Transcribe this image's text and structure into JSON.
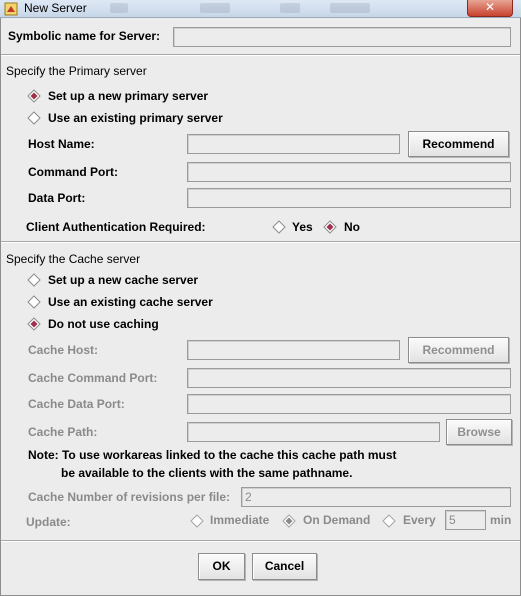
{
  "window": {
    "title": "New Server",
    "close_glyph": "✕"
  },
  "symbolic": {
    "label": "Symbolic name for Server:",
    "value": ""
  },
  "primary": {
    "section_title": "Specify the Primary server",
    "options": [
      "Set up a new primary server",
      "Use an existing primary server"
    ],
    "selected": 0,
    "host_label": "Host Name:",
    "host_value": "",
    "recommend_label": "Recommend",
    "command_port_label": "Command Port:",
    "command_port_value": "",
    "data_port_label": "Data Port:",
    "data_port_value": "",
    "auth_label": "Client Authentication Required:",
    "auth_yes": "Yes",
    "auth_no": "No",
    "auth_selected": "No"
  },
  "cache": {
    "section_title": "Specify the Cache server",
    "options": [
      "Set up a new cache server",
      "Use an existing cache server",
      "Do not use caching"
    ],
    "selected": 2,
    "host_label": "Cache Host:",
    "host_value": "",
    "recommend_label": "Recommend",
    "command_port_label": "Cache Command Port:",
    "command_port_value": "",
    "data_port_label": "Cache Data Port:",
    "data_port_value": "",
    "path_label": "Cache Path:",
    "path_value": "",
    "browse_label": "Browse",
    "note_line1": "Note: To use workareas linked to the cache this cache path must",
    "note_line2": "be available to the clients with the same pathname.",
    "revisions_label": "Cache Number of revisions per file:",
    "revisions_value": "2",
    "update_label": "Update:",
    "update_immediate": "Immediate",
    "update_on_demand": "On Demand",
    "update_every": "Every",
    "update_selected": "On Demand",
    "every_value": "5",
    "every_unit": "min"
  },
  "buttons": {
    "ok": "OK",
    "cancel": "Cancel"
  },
  "colors": {
    "radio_selected": "#a0304c",
    "title_bar": "#c7d6e8",
    "close_button": "#c8432e"
  },
  "icons": [
    "app-icon",
    "close-icon",
    "radio-diamond-icon"
  ]
}
